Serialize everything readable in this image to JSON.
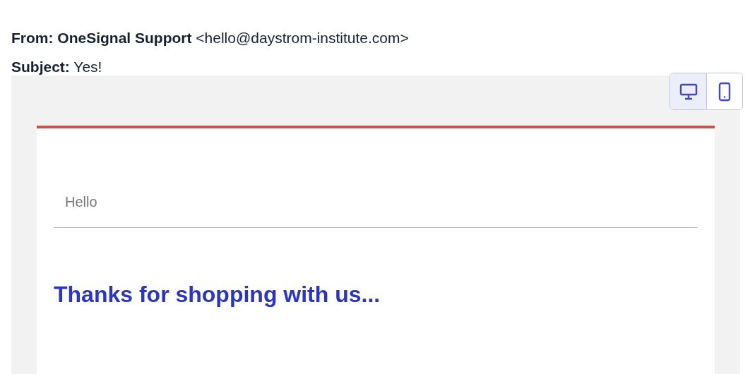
{
  "header": {
    "from_line": "**From: OneSignal Support** <hello@daystrom-institute.com>",
    "subject_line": "**Subject:** Yes!"
  },
  "view_toggle": [
    {
      "kind": "desktop",
      "selected": true
    },
    {
      "kind": "mobile",
      "selected": false
    }
  ],
  "email": {
    "greeting": "Hello",
    "heading": "Thanks for shopping with us..."
  }
}
